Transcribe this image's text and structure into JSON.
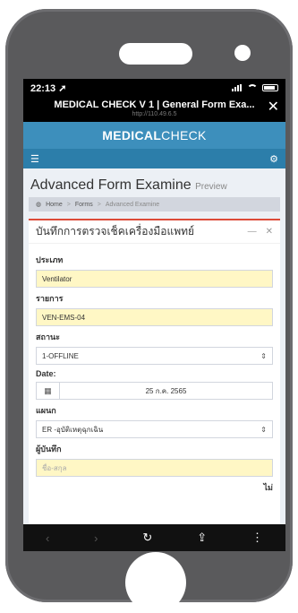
{
  "status": {
    "time": "22:13 ➚"
  },
  "browser": {
    "title": "MEDICAL CHECK V 1 | General Form Exa...",
    "url": "http://110.49.6.5"
  },
  "brand": {
    "bold": "MEDICAL",
    "light": "CHECK"
  },
  "page": {
    "title": "Advanced Form Examine",
    "subtitle": "Preview"
  },
  "breadcrumb": {
    "home": "Home",
    "forms": "Forms",
    "current": "Advanced Examine"
  },
  "form": {
    "title": "บันทึกการตรวจเช็คเครื่องมือแพทย์",
    "type_label": "ประเภท",
    "type_value": "Ventilator",
    "item_label": "รายการ",
    "item_value": "VEN-EMS-04",
    "status_label": "สถานะ",
    "status_value": "1-OFFLINE",
    "date_label": "Date:",
    "date_value": "25 ก.ค. 2565",
    "dept_label": "แผนก",
    "dept_value": "ER -อุบัติเหตุฉุกเฉิน",
    "recorder_label": "ผู้บันทึก",
    "recorder_placeholder": "ชื่อ-สกุล",
    "tail": "ไม่"
  },
  "icons": {
    "back": "chevron-left-icon",
    "forward": "chevron-right-icon",
    "reload": "reload-icon",
    "share": "share-icon",
    "more": "more-icon"
  },
  "colors": {
    "brand": "#3d8fbc",
    "navbar": "#2c7eaa",
    "box_border": "#dd4b39",
    "highlight": "#fff7c5"
  }
}
